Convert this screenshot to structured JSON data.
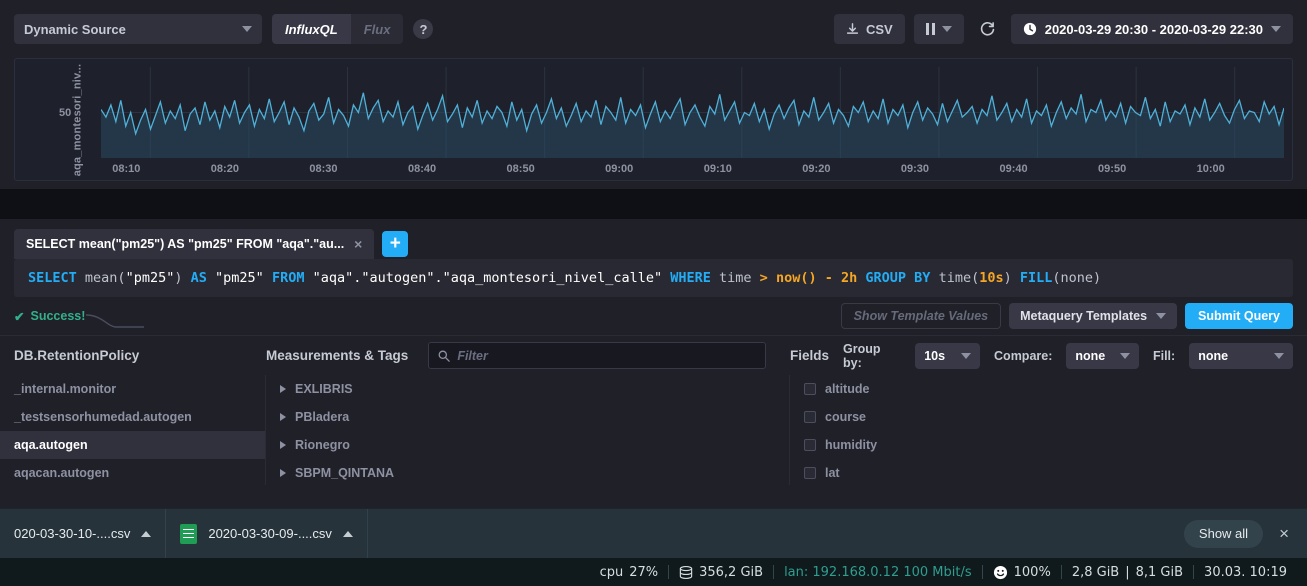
{
  "toolbar": {
    "source_label": "Dynamic Source",
    "lang_influxql": "InfluxQL",
    "lang_flux": "Flux",
    "help_glyph": "?",
    "csv_label": "CSV",
    "pause_glyph": "‖",
    "time_range": "2020-03-29 20:30 - 2020-03-29 22:30"
  },
  "graph": {
    "ylabel": "aqa_montesori_niv...",
    "ytick": "50"
  },
  "chart_data": {
    "type": "line",
    "title": "",
    "xlabel": "",
    "ylabel": "aqa_montesori_niv...",
    "xticks": [
      "08:10",
      "08:20",
      "08:30",
      "08:40",
      "08:50",
      "09:00",
      "09:10",
      "09:20",
      "09:30",
      "09:40",
      "09:50",
      "10:00"
    ],
    "yticks": [
      "50"
    ],
    "ylim": [
      20,
      80
    ],
    "grid": true,
    "legend": "none",
    "line_color": "#4fb0d8",
    "fill_color": "#2a4a63",
    "series": [
      {
        "name": "pm25",
        "values": [
          52,
          47,
          55,
          44,
          58,
          41,
          50,
          36,
          45,
          52,
          39,
          48,
          57,
          43,
          51,
          46,
          55,
          38,
          49,
          53,
          42,
          57,
          45,
          51,
          40,
          54,
          47,
          58,
          43,
          50,
          55,
          41,
          52,
          46,
          59,
          44,
          50,
          57,
          42,
          53,
          47,
          38,
          51,
          56,
          45,
          49,
          60,
          43,
          52,
          48,
          41,
          55,
          50,
          63,
          46,
          53,
          58,
          44,
          51,
          47,
          57,
          42,
          50,
          54,
          39,
          48,
          56,
          45,
          52,
          61,
          44,
          49,
          55,
          40,
          53,
          47,
          58,
          43,
          51,
          46,
          54,
          50,
          41,
          57,
          45,
          52,
          38,
          49,
          55,
          43,
          50,
          59,
          46,
          53,
          41,
          48,
          56,
          44,
          51,
          47,
          58,
          42,
          54,
          50,
          45,
          60,
          43,
          52,
          48,
          55,
          40,
          49,
          57,
          44,
          51,
          46,
          53,
          59,
          42,
          50,
          55,
          47,
          41,
          54,
          49,
          62,
          45,
          51,
          57,
          43,
          50,
          48,
          56,
          44,
          52,
          39,
          49,
          55,
          46,
          53,
          58,
          42,
          51,
          47,
          60,
          45,
          50,
          56,
          43,
          52,
          48,
          41,
          54,
          50,
          57,
          44,
          51,
          46,
          59,
          43,
          52,
          48,
          55,
          40,
          50,
          57,
          45,
          53,
          49,
          42,
          56,
          44,
          51,
          58,
          47,
          50,
          54,
          43,
          52,
          48,
          61,
          45,
          50,
          56,
          44,
          52,
          47,
          59,
          43,
          51,
          48,
          55,
          41,
          50,
          57,
          46,
          53,
          49,
          62,
          44,
          52,
          50,
          58,
          45,
          51,
          47,
          56,
          43,
          54,
          50,
          48,
          60,
          46,
          52,
          41,
          57,
          44,
          51,
          49,
          55,
          42,
          53,
          47,
          59,
          45,
          50,
          56,
          48,
          43,
          52,
          58,
          46,
          51,
          50,
          44,
          57,
          49,
          54,
          42,
          53
        ]
      }
    ]
  },
  "query_tab": {
    "label": "SELECT mean(\"pm25\") AS \"pm25\" FROM \"aqa\".\"au...",
    "close_glyph": "×",
    "add_glyph": "+"
  },
  "query": {
    "tokens": [
      {
        "t": "SELECT",
        "c": "kw"
      },
      {
        "t": " mean(",
        "c": "fn"
      },
      {
        "t": "\"pm25\"",
        "c": "str"
      },
      {
        "t": ") ",
        "c": "fn"
      },
      {
        "t": "AS",
        "c": "kw"
      },
      {
        "t": " ",
        "c": "fn"
      },
      {
        "t": "\"pm25\"",
        "c": "str"
      },
      {
        "t": " ",
        "c": "fn"
      },
      {
        "t": "FROM",
        "c": "kw"
      },
      {
        "t": " ",
        "c": "fn"
      },
      {
        "t": "\"aqa\".\"autogen\".\"aqa_montesori_nivel_calle\"",
        "c": "str"
      },
      {
        "t": " ",
        "c": "fn"
      },
      {
        "t": "WHERE",
        "c": "kw"
      },
      {
        "t": " time ",
        "c": "fn"
      },
      {
        "t": ">",
        "c": "kw-or"
      },
      {
        "t": " ",
        "c": "fn"
      },
      {
        "t": "now()",
        "c": "kw-or"
      },
      {
        "t": " ",
        "c": "fn"
      },
      {
        "t": "-",
        "c": "kw-or"
      },
      {
        "t": " ",
        "c": "fn"
      },
      {
        "t": "2h",
        "c": "kw-or"
      },
      {
        "t": " ",
        "c": "fn"
      },
      {
        "t": "GROUP BY",
        "c": "kw"
      },
      {
        "t": " time(",
        "c": "fn"
      },
      {
        "t": "10s",
        "c": "num"
      },
      {
        "t": ") ",
        "c": "fn"
      },
      {
        "t": "FILL",
        "c": "kw"
      },
      {
        "t": "(none)",
        "c": "fn"
      }
    ],
    "full_text": "SELECT mean(\"pm25\") AS \"pm25\" FROM \"aqa\".\"autogen\".\"aqa_montesori_nivel_calle\" WHERE time > now() - 2h GROUP BY time(10s) FILL(none)"
  },
  "status": {
    "success_text": "Success!",
    "check_glyph": "✔",
    "show_template_values": "Show Template Values",
    "metaquery_templates": "Metaquery Templates",
    "submit_query": "Submit Query"
  },
  "schema": {
    "db_header": "DB.RetentionPolicy",
    "meas_header": "Measurements & Tags",
    "filter_placeholder": "Filter",
    "fields_header": "Fields",
    "group_by_label": "Group by:",
    "group_by_value": "10s",
    "compare_label": "Compare:",
    "compare_value": "none",
    "fill_label": "Fill:",
    "fill_value": "none",
    "databases": [
      {
        "label": "_internal.monitor",
        "selected": false
      },
      {
        "label": "_testsensorhumedad.autogen",
        "selected": false
      },
      {
        "label": "aqa.autogen",
        "selected": true
      },
      {
        "label": "aqacan.autogen",
        "selected": false
      }
    ],
    "measurements": [
      {
        "label": "EXLIBRIS"
      },
      {
        "label": "PBladera"
      },
      {
        "label": "Rionegro"
      },
      {
        "label": "SBPM_QINTANA"
      }
    ],
    "fields": [
      {
        "label": "altitude",
        "checked": false
      },
      {
        "label": "course",
        "checked": false
      },
      {
        "label": "humidity",
        "checked": false
      },
      {
        "label": "lat",
        "checked": false
      }
    ]
  },
  "downloads": {
    "items": [
      {
        "name": "020-03-30-10-....csv",
        "has_icon": false
      },
      {
        "name": "2020-03-30-09-....csv",
        "has_icon": true
      }
    ],
    "show_all": "Show all",
    "close_glyph": "×"
  },
  "sysbar": {
    "cpu_label": "cpu",
    "cpu_value": "27%",
    "disk_value": "356,2 GiB",
    "net_value": "lan: 192.168.0.12 100 Mbit/s",
    "battery_value": "100%",
    "mem_used": "2,8 GiB",
    "mem_total": "8,1 GiB",
    "datetime": "30.03. 10:19"
  },
  "colors": {
    "accent": "#22adf6",
    "success": "#32b08c",
    "line": "#4fb0d8",
    "panel": "#202028"
  }
}
